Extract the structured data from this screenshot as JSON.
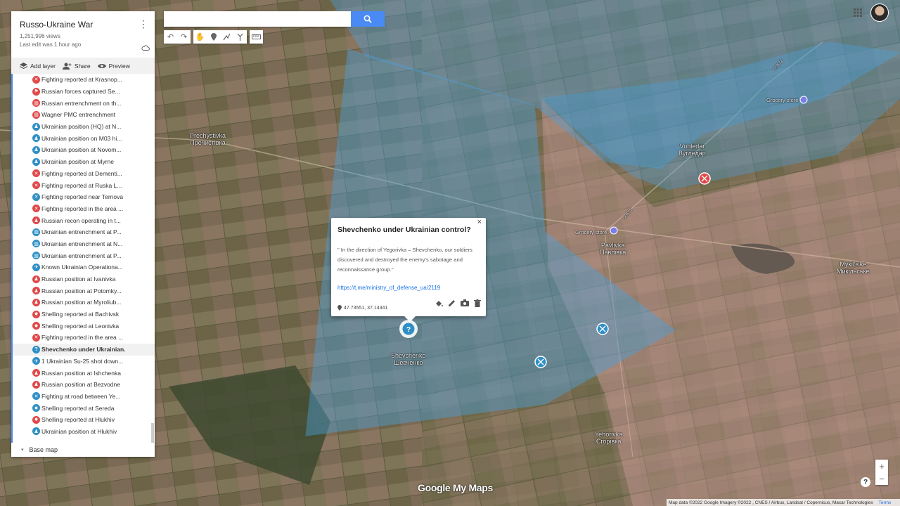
{
  "panel": {
    "title": "Russo-Ukraine War",
    "views": "1,251,996 views",
    "last_edit": "Last edit was 1 hour ago",
    "actions": {
      "add_layer": "Add layer",
      "share": "Share",
      "preview": "Preview"
    },
    "base_map": "Base map"
  },
  "layer_items": [
    {
      "label": "Fighting reported at Krasnop...",
      "icon": "crossed-swords-icon",
      "color": "#e04848"
    },
    {
      "label": "Russian forces captured Se...",
      "icon": "flag-icon",
      "color": "#e04848"
    },
    {
      "label": "Russian entrenchment on th...",
      "icon": "fortification-icon",
      "color": "#e04848"
    },
    {
      "label": "Wagner PMC entrenchment",
      "icon": "fortification-icon",
      "color": "#e04848"
    },
    {
      "label": "Ukrainian position (HQ) at N...",
      "icon": "soldier-icon",
      "color": "#2f8fc4"
    },
    {
      "label": "Ukrainian position on M03 hi...",
      "icon": "soldier-icon",
      "color": "#2f8fc4"
    },
    {
      "label": "Ukrainian position at Novom...",
      "icon": "soldier-icon",
      "color": "#2f8fc4"
    },
    {
      "label": "Ukrainian position at Myrne",
      "icon": "soldier-icon",
      "color": "#2f8fc4"
    },
    {
      "label": "Fighting reported at Dementi...",
      "icon": "crossed-swords-icon",
      "color": "#e04848"
    },
    {
      "label": "Fighting reported at Ruska L...",
      "icon": "crossed-swords-icon",
      "color": "#e04848"
    },
    {
      "label": "Fighting reported near Ternova",
      "icon": "crossed-swords-icon",
      "color": "#2f8fc4"
    },
    {
      "label": "Fighting reported in the area ...",
      "icon": "crossed-swords-icon",
      "color": "#e04848"
    },
    {
      "label": "Russian recon operating in t...",
      "icon": "soldier-icon",
      "color": "#e04848"
    },
    {
      "label": "Ukrainian entrenchment at P...",
      "icon": "fortification-icon",
      "color": "#2f8fc4"
    },
    {
      "label": "Ukrainian entrenchment at N...",
      "icon": "fortification-icon",
      "color": "#2f8fc4"
    },
    {
      "label": "Ukrainian entrenchment at P...",
      "icon": "fortification-icon",
      "color": "#2f8fc4"
    },
    {
      "label": "Known Ukrainian Operationa...",
      "icon": "airplane-icon",
      "color": "#2f8fc4"
    },
    {
      "label": "Russian position at Ivanivka",
      "icon": "soldier-icon",
      "color": "#e04848"
    },
    {
      "label": "Russian position at Potomky...",
      "icon": "soldier-icon",
      "color": "#e04848"
    },
    {
      "label": "Russian position at Myroliub...",
      "icon": "soldier-icon",
      "color": "#e04848"
    },
    {
      "label": "Shelling reported at Bachivsk",
      "icon": "explosion-icon",
      "color": "#e04848"
    },
    {
      "label": "Shelling reported at Leonivka",
      "icon": "explosion-icon",
      "color": "#e04848"
    },
    {
      "label": "Fighting reported in the area ...",
      "icon": "crossed-swords-icon",
      "color": "#e04848"
    },
    {
      "label": "Shevchenko under Ukrainian...",
      "icon": "question-icon",
      "color": "#2f8fc4",
      "selected": true
    },
    {
      "label": "1 Ukrainian Su-25 shot down...",
      "icon": "airplane-icon",
      "color": "#2f8fc4"
    },
    {
      "label": "Russian position at Ishchenka",
      "icon": "soldier-icon",
      "color": "#e04848"
    },
    {
      "label": "Russian position at Bezvodne",
      "icon": "soldier-icon",
      "color": "#e04848"
    },
    {
      "label": "Fighting at road between Ye...",
      "icon": "crossed-swords-icon",
      "color": "#2f8fc4"
    },
    {
      "label": "Shelling reported at Sereda",
      "icon": "explosion-icon",
      "color": "#2f8fc4"
    },
    {
      "label": "Shelling reported at Hlukhiv",
      "icon": "explosion-icon",
      "color": "#e04848"
    },
    {
      "label": "Ukrainian position at Hlukhiv",
      "icon": "soldier-icon",
      "color": "#2f8fc4"
    }
  ],
  "popup": {
    "title": "Shevchenko under Ukrainian control?",
    "body": "\" In the direction of Yegorivka – Shevchenko, our soldiers discovered and destroyed the enemy's sabotage and reconnaissance group.\"",
    "link": "https://t.me/ministry_of_defense_ua/2119",
    "coords": "47.73551, 37.14341",
    "close": "×"
  },
  "map_labels": {
    "prechystivka": "Prechystivka",
    "prechystivka_uk": "Пречистівка",
    "vuhledar": "Vuhledar",
    "vuhledar_uk": "Вугледар",
    "pavlivka": "Pavlivka",
    "pavlivka_uk": "Павлівка",
    "mykilske": "Mykil's'ke",
    "mykilske_uk": "Микільське",
    "shevchenko": "Shevchenko",
    "shevchenko_uk": "Шевченко",
    "yehorivka": "Yehorivka",
    "yehorivka_uk": "Єгорівка",
    "grocery1": "Grocery store",
    "grocery2": "Grocery store",
    "road1": "O0532",
    "road2": "O0532"
  },
  "colors": {
    "ukraine_zone": "#4aa3e0",
    "russia_zone": "#f2b0b8",
    "accent": "#4a8af4"
  },
  "footer": {
    "attribution": "Map data ©2022 Google Imagery ©2022 , CNES / Airbus, Landsat / Copernicus, Maxar Technologies",
    "terms": "Terms"
  },
  "logo": "Google My Maps",
  "zoom": {
    "in": "+",
    "out": "−"
  },
  "help": "?"
}
